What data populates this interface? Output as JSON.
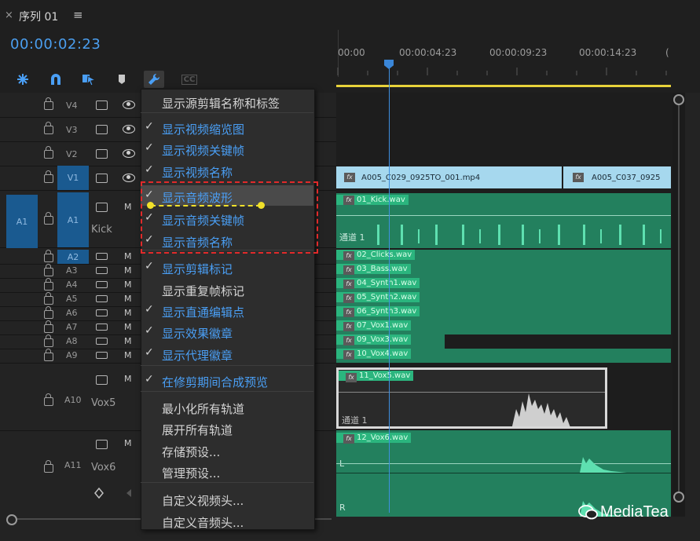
{
  "sequence": {
    "close_glyph": "×",
    "title": "序列 01",
    "menu_glyph": "≡"
  },
  "timecode": "00:00:02:23",
  "toolbar": {
    "icons": [
      "snap-insert-icon",
      "magnet-icon",
      "linked-select-icon",
      "marker-icon",
      "wrench-icon",
      "cc-icon"
    ],
    "cc_label": "CC"
  },
  "ruler": {
    "ticks": [
      "00:00",
      "00:00:04:23",
      "00:00:09:23",
      "00:00:14:23"
    ],
    "edge_glyph": "("
  },
  "tracks": {
    "video": [
      {
        "label": "V4"
      },
      {
        "label": "V3"
      },
      {
        "label": "V2"
      },
      {
        "label": "V1"
      }
    ],
    "a1": {
      "source": "A1",
      "label": "A1",
      "name": "Kick",
      "mute": "M"
    },
    "audio_small": [
      {
        "label": "A2",
        "mute": "M"
      },
      {
        "label": "A3",
        "mute": "M"
      },
      {
        "label": "A4",
        "mute": "M"
      },
      {
        "label": "A5",
        "mute": "M"
      },
      {
        "label": "A6",
        "mute": "M"
      },
      {
        "label": "A7",
        "mute": "M"
      },
      {
        "label": "A8",
        "mute": "M"
      },
      {
        "label": "A9",
        "mute": "M"
      }
    ],
    "a10": {
      "label": "A10",
      "name": "Vox5",
      "mute": "M"
    },
    "a11": {
      "label": "A11",
      "name": "Vox6",
      "mute": "M"
    }
  },
  "clips": {
    "video": [
      "A005_C029_0925TO_001.mp4",
      "A005_C037_0925"
    ],
    "fx": "fx",
    "audio": {
      "a1": "01_Kick.wav",
      "small": [
        "02_Clicks.wav",
        "03_Bass.wav",
        "04_Synth1.wav",
        "05_Synth2.wav",
        "06_Synth3.wav",
        "07_Vox1.wav",
        "09_Vox3.wav",
        "10_Vox4.wav"
      ],
      "a10": "11_Vox5.wav",
      "a11": "12_Vox6.wav"
    },
    "channel_label": "通道 1",
    "left_label": "L",
    "right_label": "R"
  },
  "menu": {
    "items": [
      {
        "label": "显示源剪辑名称和标签",
        "checked": false
      },
      {
        "label": "显示视频缩览图",
        "checked": true
      },
      {
        "label": "显示视频关键帧",
        "checked": true
      },
      {
        "label": "显示视频名称",
        "checked": true
      },
      {
        "label": "显示音频波形",
        "checked": true
      },
      {
        "label": "显示音频关键帧",
        "checked": true
      },
      {
        "label": "显示音频名称",
        "checked": true
      },
      {
        "label": "显示剪辑标记",
        "checked": true
      },
      {
        "label": "显示重复帧标记",
        "checked": false
      },
      {
        "label": "显示直通编辑点",
        "checked": true
      },
      {
        "label": "显示效果徽章",
        "checked": true
      },
      {
        "label": "显示代理徽章",
        "checked": true
      },
      {
        "label": "在修剪期间合成预览",
        "checked": true
      },
      {
        "label": "最小化所有轨道",
        "checked": false
      },
      {
        "label": "展开所有轨道",
        "checked": false
      },
      {
        "label": "存储预设...",
        "checked": false
      },
      {
        "label": "管理预设...",
        "checked": false
      },
      {
        "label": "自定义视频头...",
        "checked": false
      },
      {
        "label": "自定义音频头...",
        "checked": false
      }
    ],
    "check_glyph": "✓"
  },
  "watermark": "MediaTea",
  "colors": {
    "accent_blue": "#4a9ff5",
    "audio_clip": "#23805e",
    "video_clip": "#a6d8ee",
    "annotation_red": "#e12a2a",
    "annotation_yellow": "#f0e02a"
  }
}
